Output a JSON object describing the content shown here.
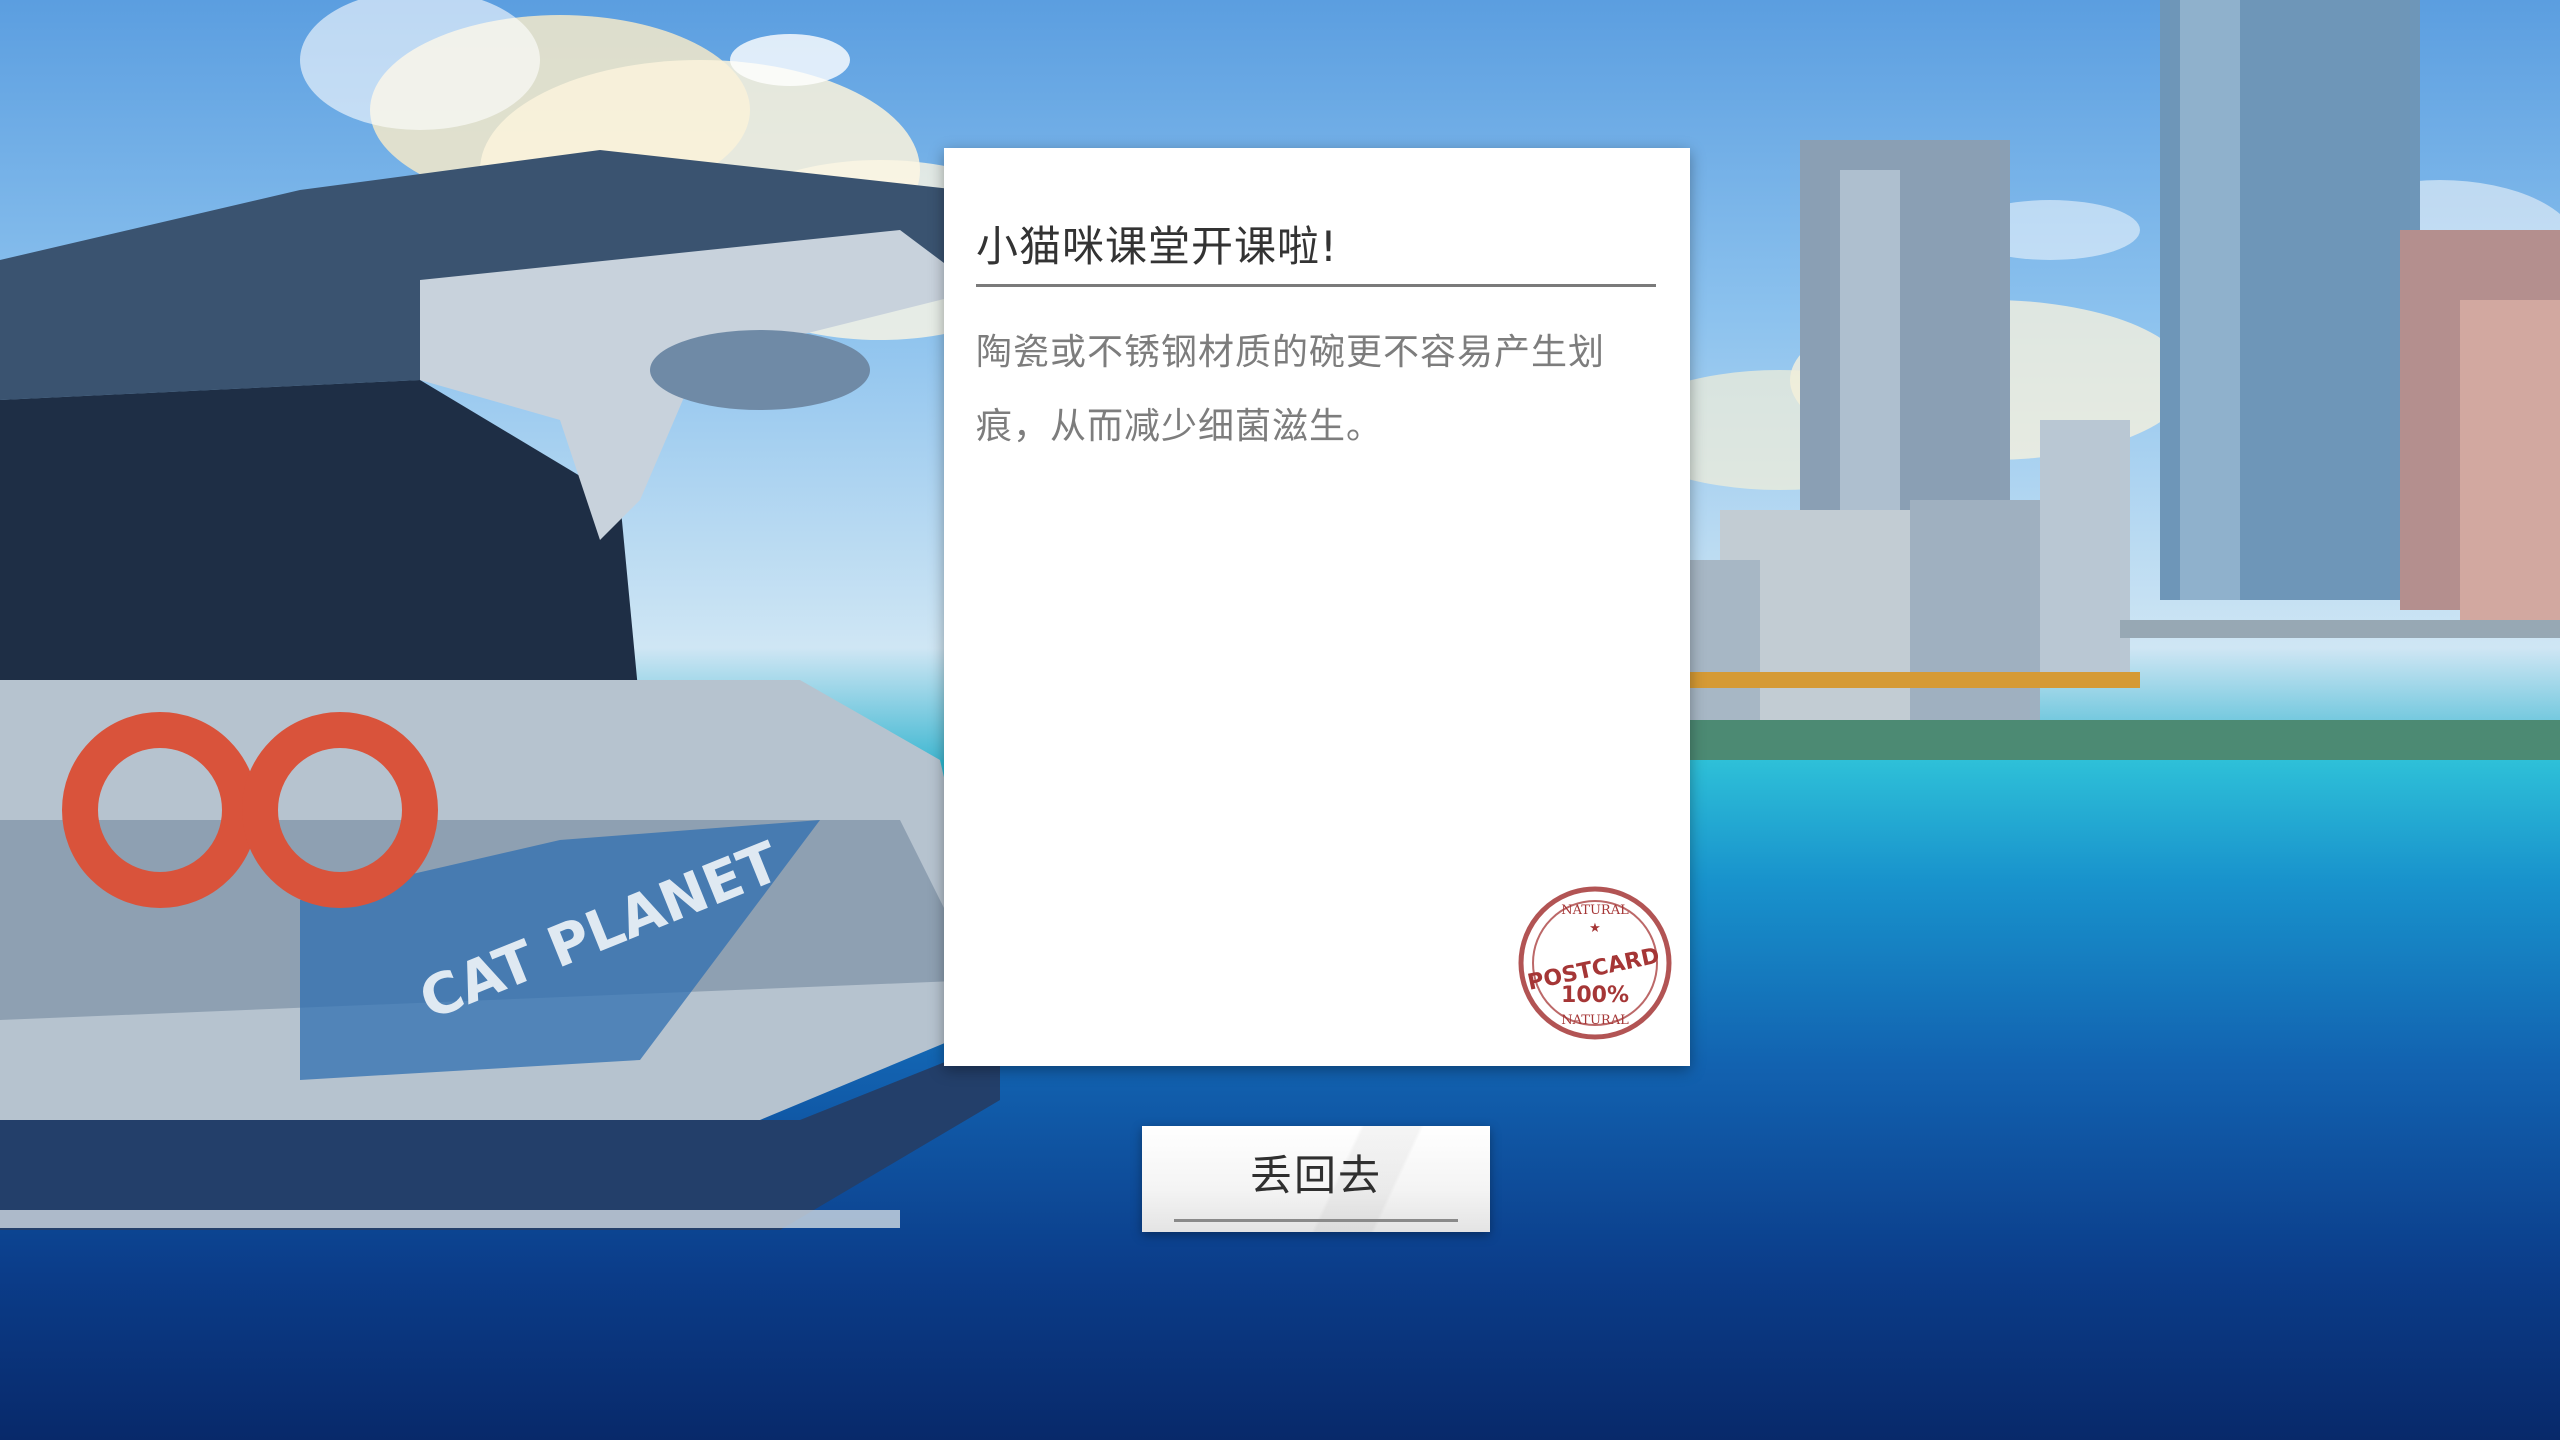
{
  "postcard": {
    "title": "小猫咪课堂开课啦!",
    "body": "陶瓷或不锈钢材质的碗更不容易产生划痕，从而减少细菌滋生。",
    "stamp": {
      "top_text": "NATURAL",
      "center_text": "POSTCARD",
      "percent_text": "100%",
      "bottom_text": "NATURAL"
    }
  },
  "actions": {
    "discard_label": "丢回去"
  },
  "background": {
    "boat_text": "CAT PLANET"
  },
  "colors": {
    "card_background": "#ffffff",
    "title_text": "#333333",
    "body_text": "#7d7d7d",
    "stamp_red": "#a53636",
    "sea_top": "#2ec0d8",
    "sea_bottom": "#08296a"
  }
}
